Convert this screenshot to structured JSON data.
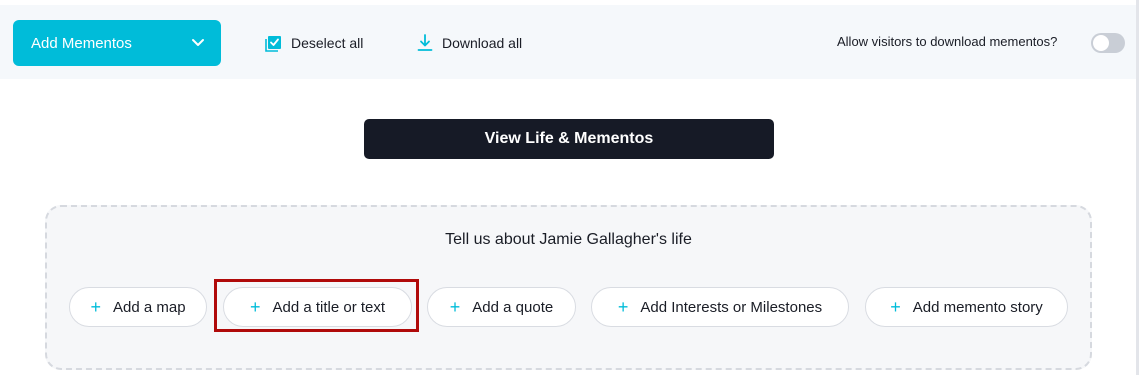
{
  "toolbar": {
    "add_mementos_label": "Add Mementos",
    "deselect_label": "Deselect all",
    "download_label": "Download all",
    "allow_download_label": "Allow visitors to download mementos?",
    "allow_download_enabled": false
  },
  "main": {
    "view_button_label": "View Life & Mementos",
    "life_prompt": "Tell us about Jamie Gallagher's life",
    "actions": [
      {
        "label": "Add a map"
      },
      {
        "label": "Add a title or text"
      },
      {
        "label": "Add a quote"
      },
      {
        "label": "Add Interests or Milestones"
      },
      {
        "label": "Add memento story"
      }
    ]
  },
  "colors": {
    "accent": "#00bcd9",
    "dark_button": "#161a26",
    "highlight": "#b00a0a"
  }
}
